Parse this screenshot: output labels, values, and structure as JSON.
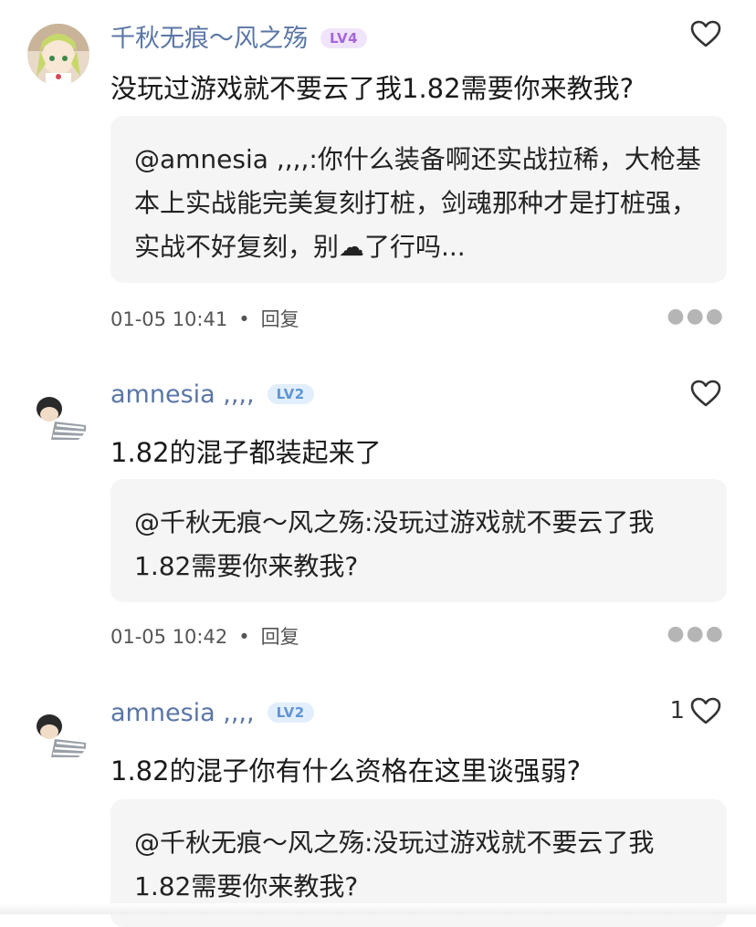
{
  "comments": [
    {
      "username": "千秋无痕～风之殇",
      "level": "LV4",
      "likes": "",
      "text": "没玩过游戏就不要云了我1.82需要你来教我?",
      "quote": "@amnesia ,,,,:你什么装备啊还实战拉稀，大枪基本上实战能完美复刻打桩，剑魂那种才是打桩强，实战不好复刻，别☁了行吗...",
      "time": "01-05 10:41",
      "reply_label": "回复",
      "avatar_icon": "anime-girl-avatar-icon"
    },
    {
      "username": "amnesia ,,,,",
      "level": "LV2",
      "likes": "",
      "text": "1.82的混子都装起来了",
      "quote": "@千秋无痕～风之殇:没玩过游戏就不要云了我1.82需要你来教我?",
      "time": "01-05 10:42",
      "reply_label": "回复",
      "avatar_icon": "child-avatar-icon"
    },
    {
      "username": "amnesia ,,,,",
      "level": "LV2",
      "likes": "1",
      "text": "1.82的混子你有什么资格在这里谈强弱?",
      "quote": "@千秋无痕～风之殇:没玩过游戏就不要云了我1.82需要你来教我?",
      "time": "",
      "reply_label": "",
      "avatar_icon": "child-avatar-icon"
    }
  ],
  "colors": {
    "username": "#5a76a6",
    "lv4_badge": "#a667d9",
    "lv2_badge": "#5f95d6",
    "quote_bg": "#f5f5f5"
  },
  "more_icon": "more-dots-icon",
  "like_icon": "heart-outline-icon"
}
